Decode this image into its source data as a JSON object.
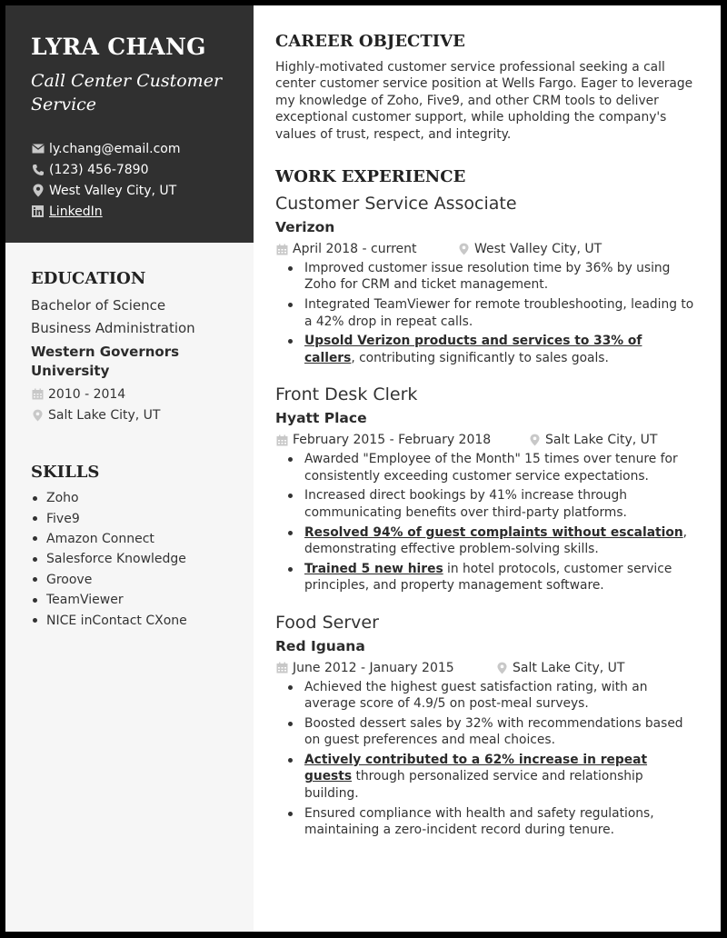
{
  "header": {
    "name": "LYRA CHANG",
    "title": "Call Center Customer Service",
    "contacts": [
      {
        "icon": "envelope-icon",
        "text": "ly.chang@email.com"
      },
      {
        "icon": "phone-icon",
        "text": "(123) 456-7890"
      },
      {
        "icon": "map-pin-icon",
        "text": "West Valley City, UT"
      },
      {
        "icon": "linkedin-icon",
        "text": "LinkedIn"
      }
    ]
  },
  "education": {
    "heading": "EDUCATION",
    "degree": "Bachelor of Science",
    "field": "Business Administration",
    "school": "Western Governors University",
    "dates": "2010 - 2014",
    "location": "Salt Lake City, UT"
  },
  "skills": {
    "heading": "SKILLS",
    "items": [
      "Zoho",
      "Five9",
      "Amazon Connect",
      "Salesforce Knowledge",
      "Groove",
      "TeamViewer",
      "NICE inContact CXone"
    ]
  },
  "objective": {
    "heading": "CAREER OBJECTIVE",
    "text": "Highly-motivated customer service professional seeking a call center customer service position at Wells Fargo. Eager to leverage my knowledge of Zoho, Five9, and other CRM tools to deliver exceptional customer support, while upholding the company's values of trust, respect, and integrity."
  },
  "work": {
    "heading": "WORK EXPERIENCE",
    "jobs": [
      {
        "title": "Customer Service Associate",
        "company": "Verizon",
        "dates": "April 2018 - current",
        "location": "West Valley City, UT",
        "bullets": [
          {
            "highlight": "",
            "text": "Improved customer issue resolution time by 36% by using Zoho for CRM and ticket management."
          },
          {
            "highlight": "",
            "text": "Integrated TeamViewer for remote troubleshooting, leading to a 42% drop in repeat calls."
          },
          {
            "highlight": "Upsold Verizon products and services to 33% of callers",
            "text": ", contributing significantly to sales goals."
          }
        ]
      },
      {
        "title": "Front Desk Clerk",
        "company": "Hyatt Place",
        "dates": "February 2015 - February 2018",
        "location": "Salt Lake City, UT",
        "bullets": [
          {
            "highlight": "",
            "text": "Awarded \"Employee of the Month\" 15 times over tenure for consistently exceeding customer service expectations."
          },
          {
            "highlight": "",
            "text": "Increased direct bookings by 41% increase through communicating benefits over third-party platforms."
          },
          {
            "highlight": "Resolved 94% of guest complaints without escalation",
            "text": ", demonstrating effective problem-solving skills."
          },
          {
            "highlight": "Trained 5 new hires",
            "text": " in hotel protocols, customer service principles, and property management software."
          }
        ]
      },
      {
        "title": "Food Server",
        "company": "Red Iguana",
        "dates": "June 2012 - January 2015",
        "location": "Salt Lake City, UT",
        "bullets": [
          {
            "highlight": "",
            "text": "Achieved the highest guest satisfaction rating, with an average score of 4.9/5 on post-meal surveys."
          },
          {
            "highlight": "",
            "text": "Boosted dessert sales by 32% with recommendations based on guest preferences and meal choices."
          },
          {
            "highlight": "Actively contributed to a 62% increase in repeat guests",
            "text": " through personalized service and relationship building."
          },
          {
            "highlight": "",
            "text": "Ensured compliance with health and safety regulations, maintaining a zero-incident record during tenure."
          }
        ]
      }
    ]
  },
  "colors": {
    "sidebar_header_bg": "#303030",
    "sidebar_bg": "#f6f6f6",
    "text": "#333333",
    "icon_gray": "#c8c8c8",
    "frame": "#000000"
  }
}
